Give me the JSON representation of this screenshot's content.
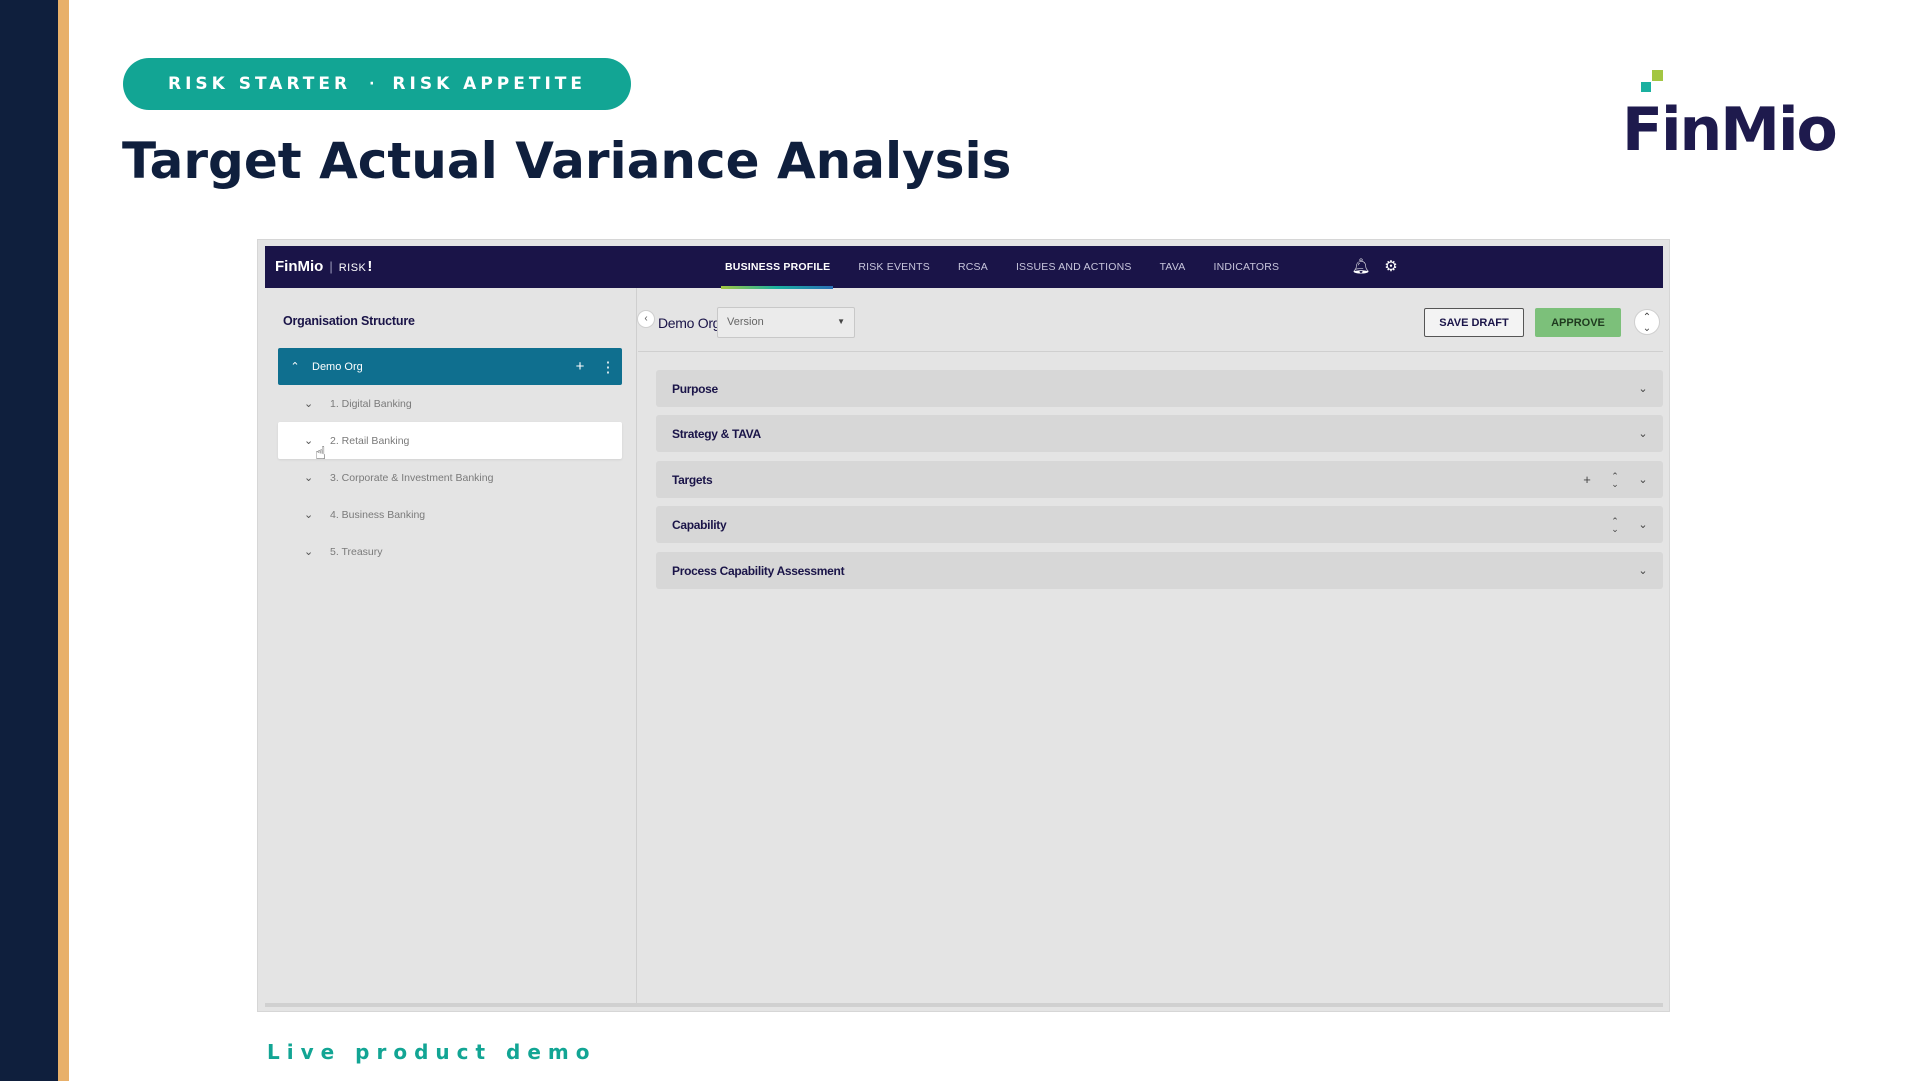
{
  "slide": {
    "pill_left": "RISK STARTER",
    "pill_sep": "·",
    "pill_right": "RISK APPETITE",
    "title": "Target Actual Variance Analysis",
    "caption": "Live product demo",
    "brand_logo_text": "FinMio",
    "colors": {
      "navy": "#0f1f3d",
      "gold": "#e8b06a",
      "teal": "#12a594"
    }
  },
  "app": {
    "logo": {
      "brand": "FinMio",
      "sep": "|",
      "product": "RISK",
      "bang": "!"
    },
    "nav": [
      {
        "label": "BUSINESS PROFILE",
        "active": true
      },
      {
        "label": "RISK EVENTS"
      },
      {
        "label": "RCSA"
      },
      {
        "label": "ISSUES AND ACTIONS"
      },
      {
        "label": "TAVA"
      },
      {
        "label": "INDICATORS"
      }
    ],
    "nav_icons": [
      "bell-icon",
      "gear-icon"
    ],
    "sidebar": {
      "title": "Organisation Structure",
      "root": "Demo Org",
      "items": [
        {
          "label": "1. Digital Banking"
        },
        {
          "label": "2. Retail Banking",
          "selected": true
        },
        {
          "label": "3. Corporate & Investment Banking"
        },
        {
          "label": "4. Business Banking"
        },
        {
          "label": "5. Treasury"
        }
      ]
    },
    "main": {
      "org_name": "Demo Org",
      "version_placeholder": "Version",
      "save_label": "SAVE DRAFT",
      "approve_label": "APPROVE",
      "sections": [
        {
          "title": "Purpose"
        },
        {
          "title": "Strategy & TAVA"
        },
        {
          "title": "Targets"
        },
        {
          "title": "Capability"
        },
        {
          "title": "Process Capability Assessment"
        }
      ]
    }
  }
}
